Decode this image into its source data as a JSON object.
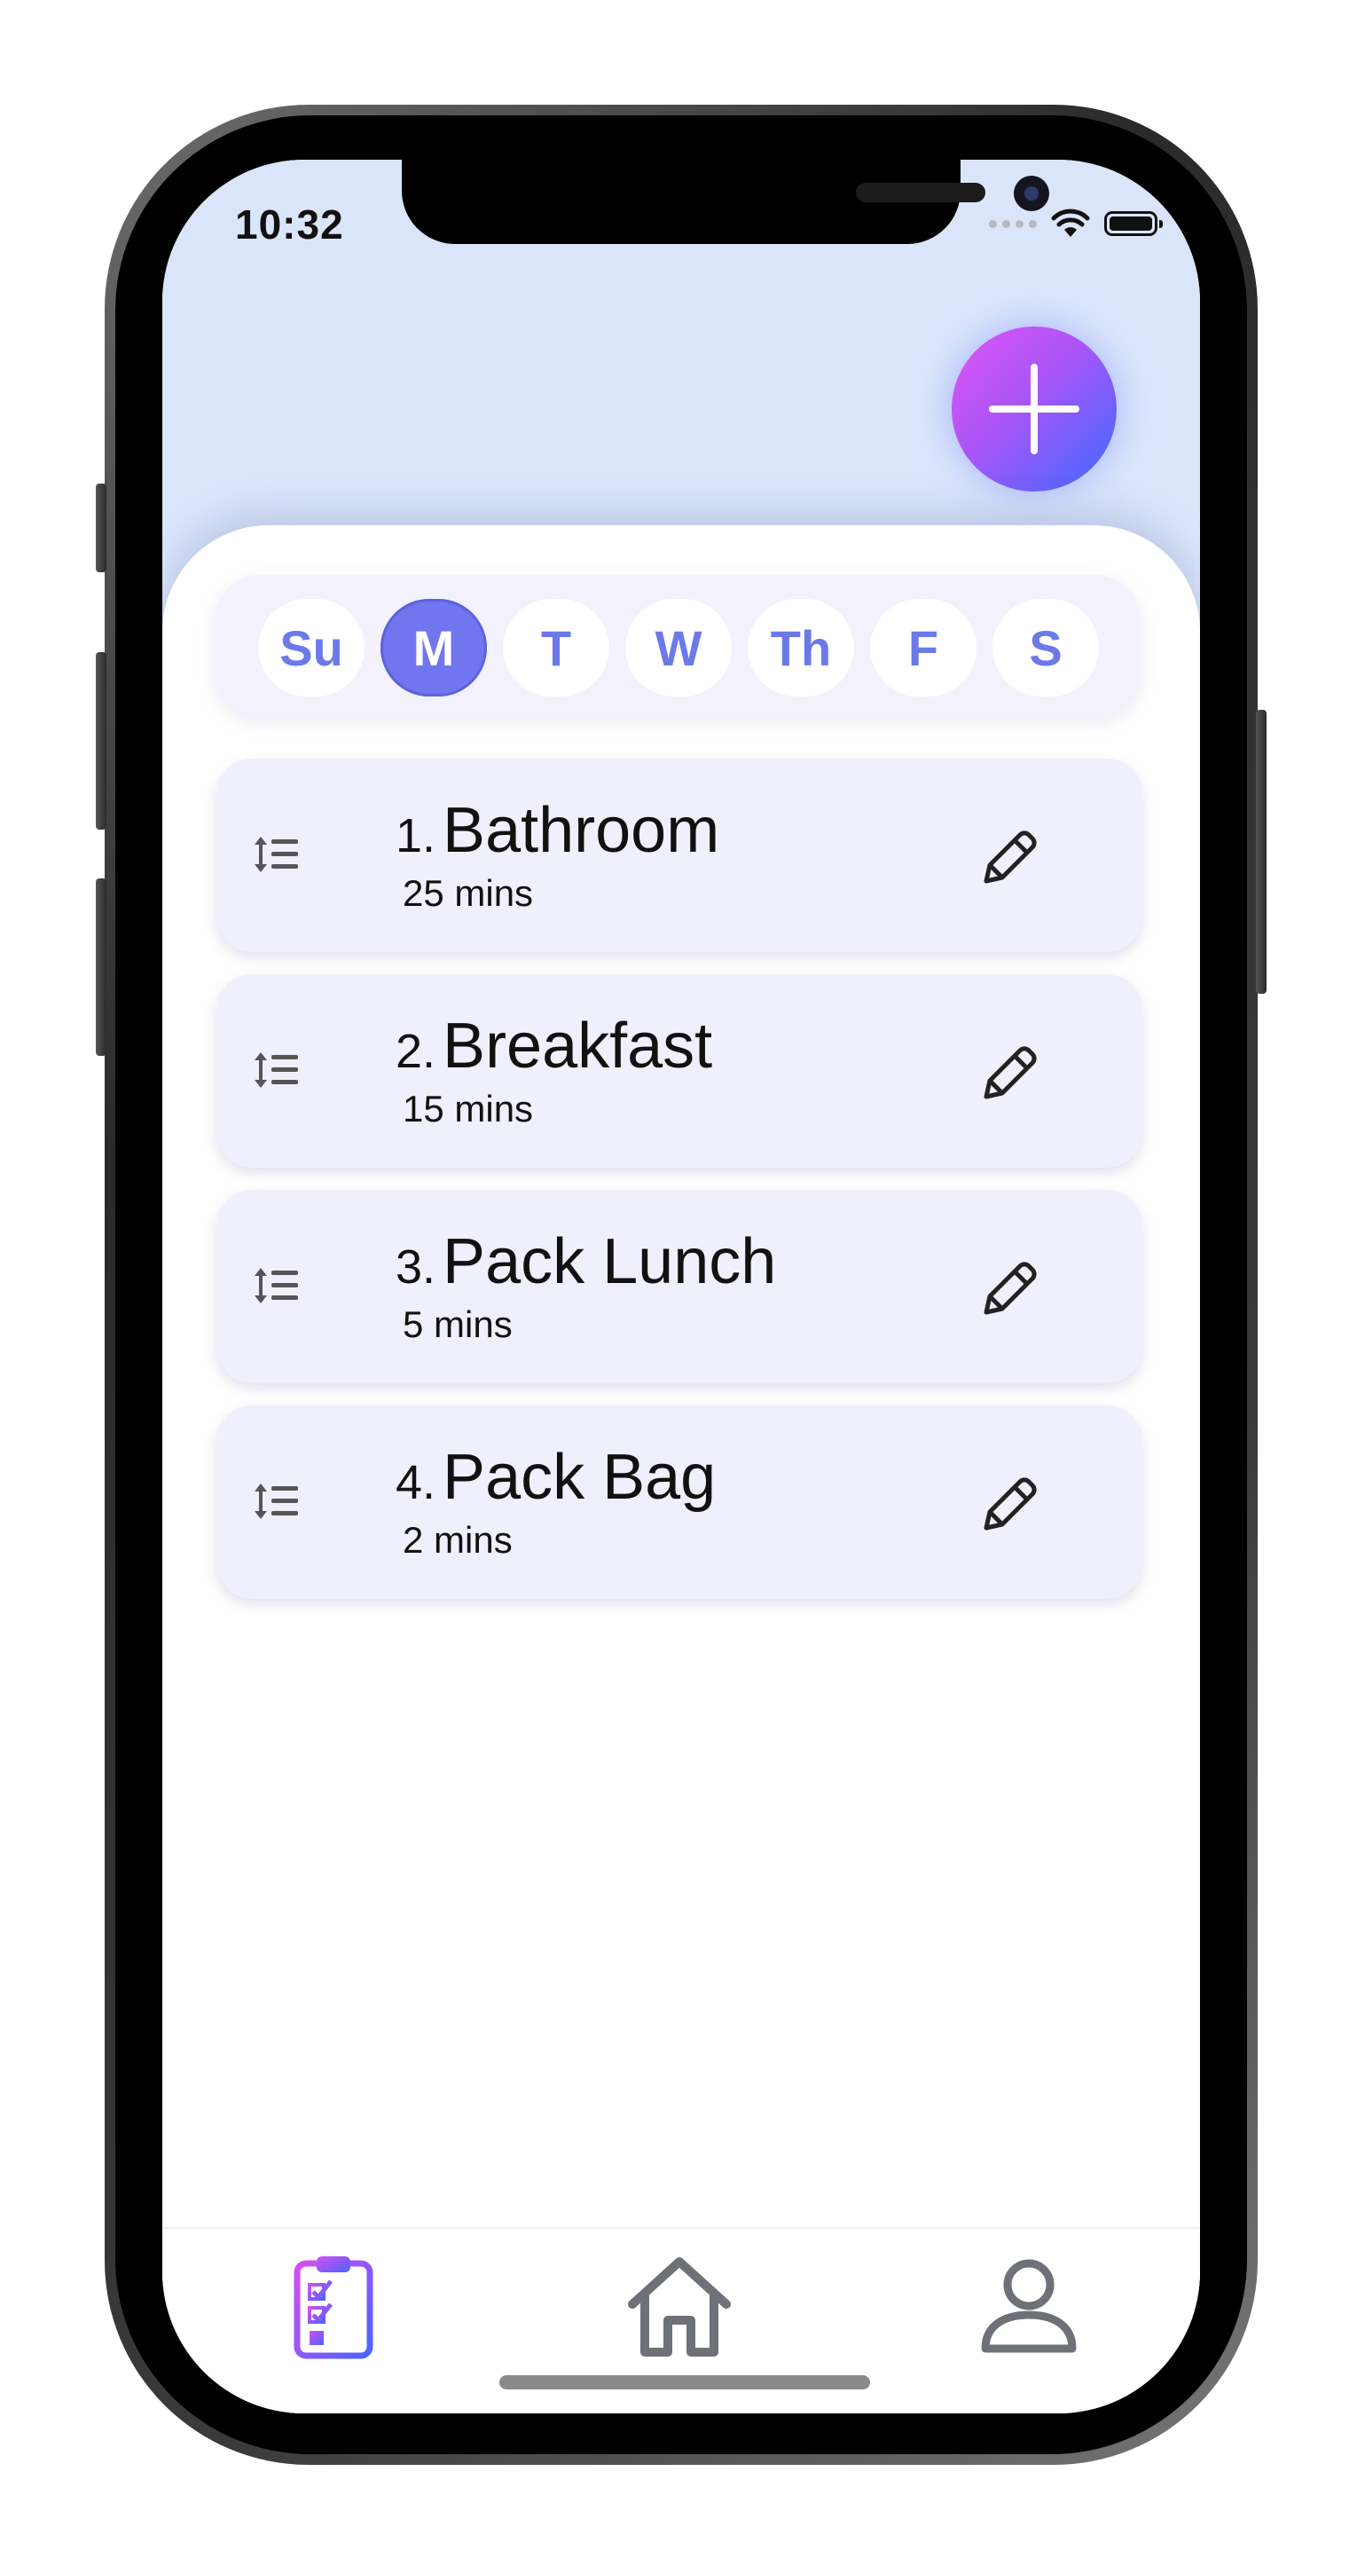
{
  "status_bar": {
    "time": "10:32"
  },
  "fab": {
    "icon": "plus-icon"
  },
  "days": [
    {
      "label": "Su",
      "selected": false
    },
    {
      "label": "M",
      "selected": true
    },
    {
      "label": "T",
      "selected": false
    },
    {
      "label": "W",
      "selected": false
    },
    {
      "label": "Th",
      "selected": false
    },
    {
      "label": "F",
      "selected": false
    },
    {
      "label": "S",
      "selected": false
    }
  ],
  "tasks": [
    {
      "index": "1.",
      "name": "Bathroom",
      "duration": "25 mins"
    },
    {
      "index": "2.",
      "name": "Breakfast",
      "duration": "15 mins"
    },
    {
      "index": "3.",
      "name": "Pack Lunch",
      "duration": "5 mins"
    },
    {
      "index": "4.",
      "name": "Pack Bag",
      "duration": "2 mins"
    }
  ],
  "bottom_nav": [
    {
      "icon": "clipboard-checklist-icon",
      "active": true
    },
    {
      "icon": "home-icon",
      "active": false
    },
    {
      "icon": "profile-icon",
      "active": false
    }
  ],
  "colors": {
    "accent": "#7176ee",
    "day_text": "#6b7ae8",
    "card_bg": "#f0effc",
    "header_bg": "#dbe5fa",
    "fab_gradient_start": "#e055f4",
    "fab_gradient_end": "#3c6bff",
    "nav_inactive": "#6e7178"
  }
}
